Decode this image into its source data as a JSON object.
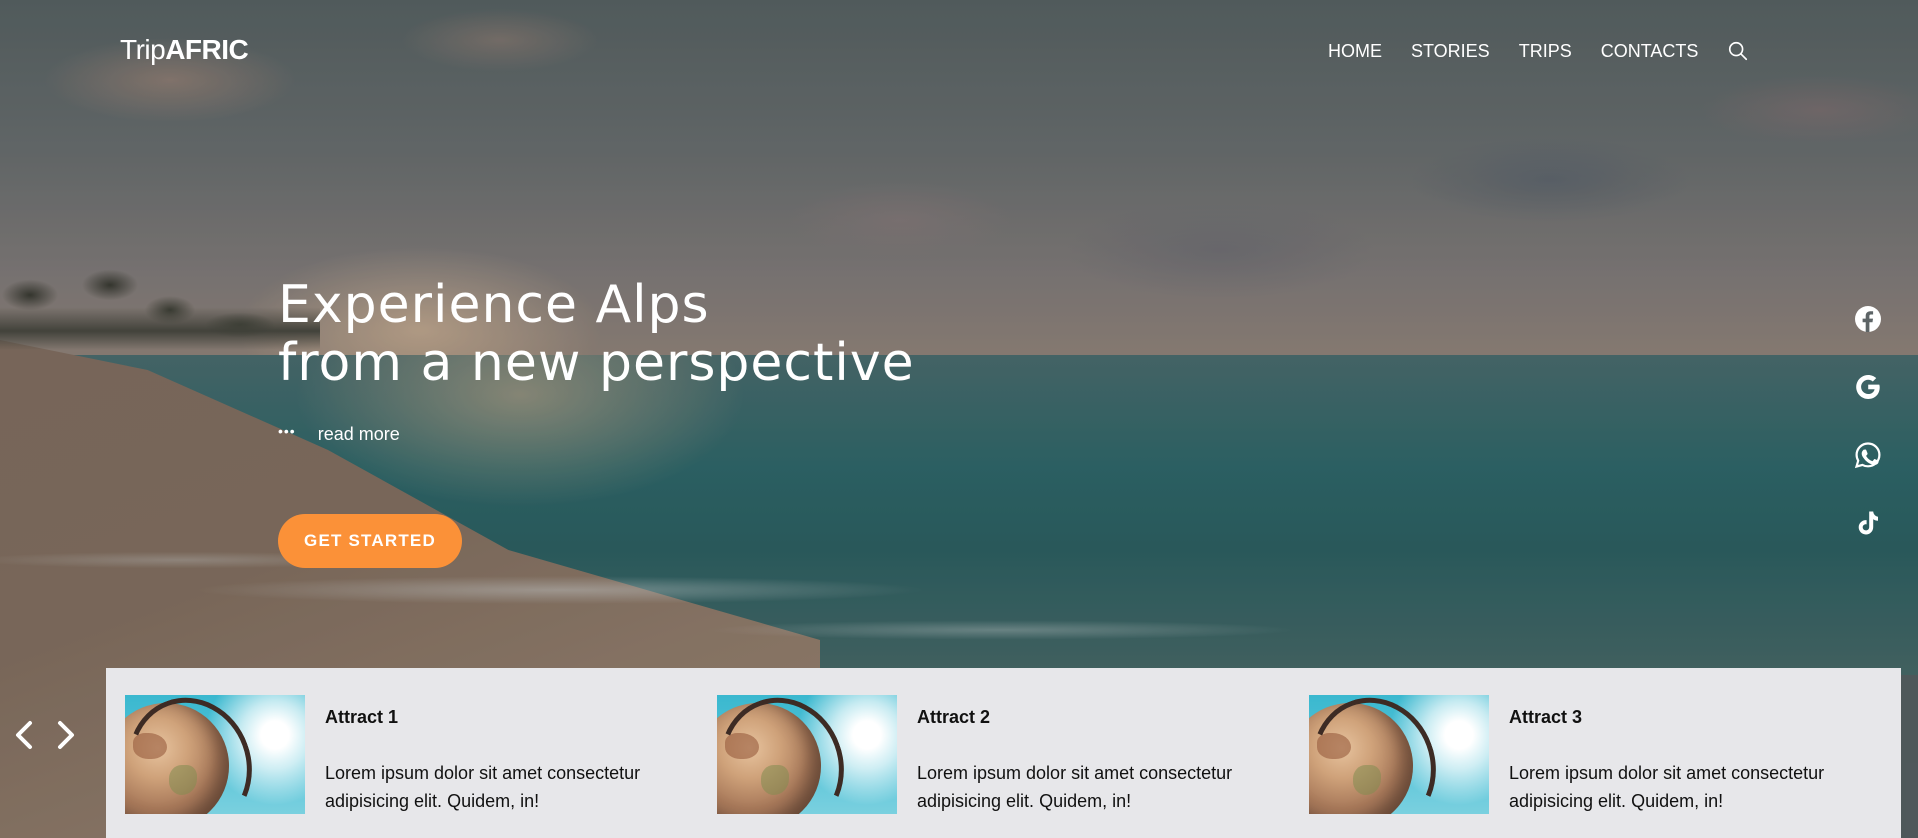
{
  "brand": {
    "name_light": "Trip",
    "name_bold": "AFRIC"
  },
  "nav": {
    "items": [
      "HOME",
      "STORIES",
      "TRIPS",
      "CONTACTS"
    ],
    "search_icon": "search-icon"
  },
  "hero": {
    "headline_line1": "Experience Alps",
    "headline_line2": "from a new perspective",
    "read_more_dots": "•••",
    "read_more_label": "read more",
    "cta_label": "GET STARTED"
  },
  "social": [
    "facebook-icon",
    "google-icon",
    "whatsapp-icon",
    "tiktok-icon"
  ],
  "carousel": {
    "prev_icon": "chevron-left-icon",
    "next_icon": "chevron-right-icon"
  },
  "attractions": [
    {
      "title": "Attract 1",
      "description": "Lorem ipsum dolor sit amet consectetur adipisicing elit. Quidem, in!"
    },
    {
      "title": "Attract 2",
      "description": "Lorem ipsum dolor sit amet consectetur adipisicing elit. Quidem, in!"
    },
    {
      "title": "Attract 3",
      "description": "Lorem ipsum dolor sit amet consectetur adipisicing elit. Quidem, in!"
    }
  ],
  "colors": {
    "accent": "#fb9138",
    "strip_background": "#e7e7ea",
    "text_light": "#ffffff"
  }
}
